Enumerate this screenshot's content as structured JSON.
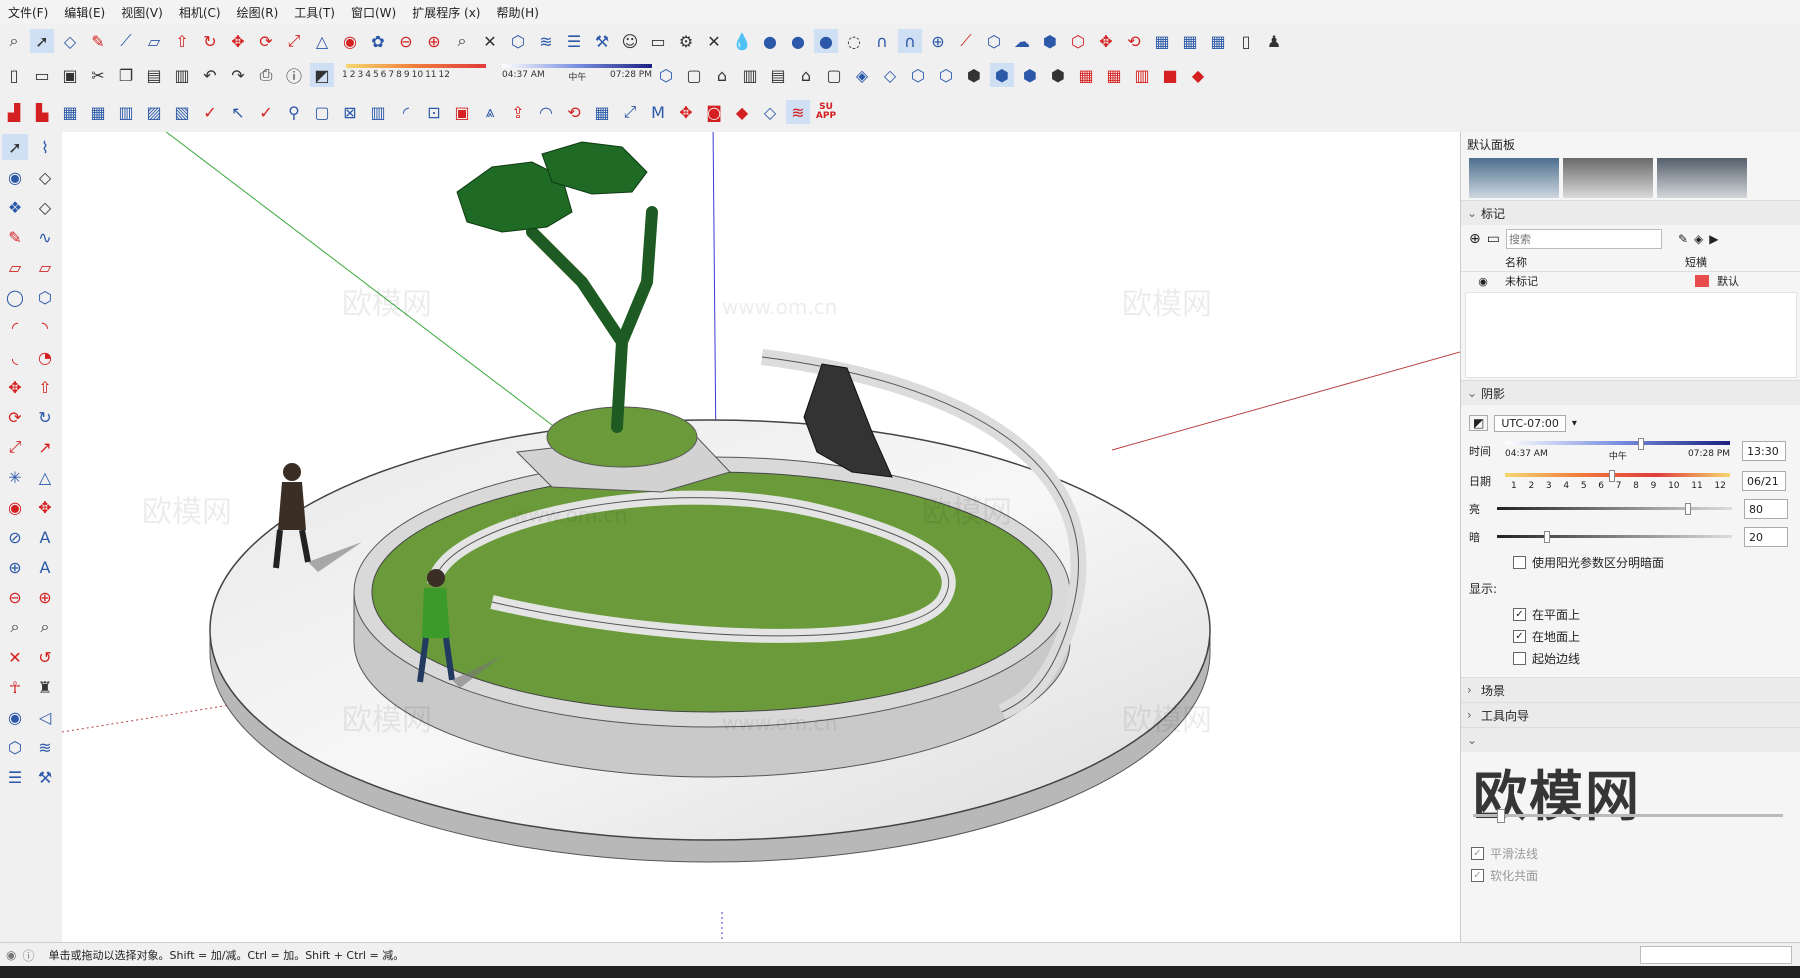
{
  "menu": [
    "文件(F)",
    "编辑(E)",
    "视图(V)",
    "相机(C)",
    "绘图(R)",
    "工具(T)",
    "窗口(W)",
    "扩展程序 (x)",
    "帮助(H)"
  ],
  "toolbar": {
    "time_scale": [
      "1",
      "2",
      "3",
      "4",
      "5",
      "6",
      "7",
      "8",
      "9",
      "10",
      "11",
      "12"
    ],
    "time_start": "04:37 AM",
    "time_mid": "中午",
    "time_end": "07:28 PM",
    "su_app": "SU APP"
  },
  "panel": {
    "title": "默认面板",
    "tags": {
      "header": "标记",
      "search_placeholder": "搜索",
      "col_name": "名称",
      "col_dash": "短横",
      "row_name": "未标记",
      "row_dash": "默认",
      "row_color": "#e84c4c"
    },
    "shadows": {
      "header": "阴影",
      "timezone": "UTC-07:00",
      "time_label": "时间",
      "time_start": "04:37 AM",
      "time_mid": "中午",
      "time_end": "07:28 PM",
      "time_value": "13:30",
      "date_label": "日期",
      "date_value": "06/21",
      "bright_label": "亮",
      "bright_value": "80",
      "dark_label": "暗",
      "dark_value": "20",
      "sun_label": "使用阳光参数区分明暗面",
      "display_label": "显示:",
      "on_faces": "在平面上",
      "on_ground": "在地面上",
      "from_edges": "起始边线"
    },
    "scenes": "场景",
    "instructor": "工具向导",
    "smoothing": {
      "smooth_normals": "平滑法线",
      "soften_coplanar": "软化共面"
    }
  },
  "watermark": "欧模网",
  "watermark_url": "www.om.cn",
  "status": "单击或拖动以选择对象。Shift = 加/减。Ctrl = 加。Shift + Ctrl = 减。"
}
